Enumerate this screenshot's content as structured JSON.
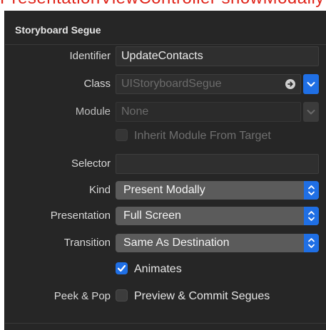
{
  "annotation": {
    "top_text": "PresentationViewController showModally"
  },
  "panel": {
    "title": "Storyboard Segue"
  },
  "identifier": {
    "label": "Identifier",
    "value": "UpdateContacts"
  },
  "class_field": {
    "label": "Class",
    "placeholder": "UIStoryboardSegue"
  },
  "module_field": {
    "label": "Module",
    "placeholder": "None"
  },
  "inherit_module": {
    "label": "Inherit Module From Target",
    "checked": false
  },
  "selector": {
    "label": "Selector",
    "value": ""
  },
  "kind": {
    "label": "Kind",
    "selected": "Present Modally"
  },
  "presentation": {
    "label": "Presentation",
    "selected": "Full Screen"
  },
  "transition": {
    "label": "Transition",
    "selected": "Same As Destination"
  },
  "animates": {
    "label": "Animates",
    "checked": true
  },
  "peek_pop": {
    "label": "Peek & Pop",
    "checkbox_label": "Preview & Commit Segues",
    "checked": false
  },
  "colors": {
    "panel_bg": "#262626",
    "accent": "#1f6fe5",
    "annotation": "#e0251b"
  },
  "icons": {
    "class_arrow": "arrow-right-circle-icon",
    "dropdown": "chevron-down-icon",
    "stepper": "up-down-chevron-icon",
    "check": "checkmark-icon"
  }
}
